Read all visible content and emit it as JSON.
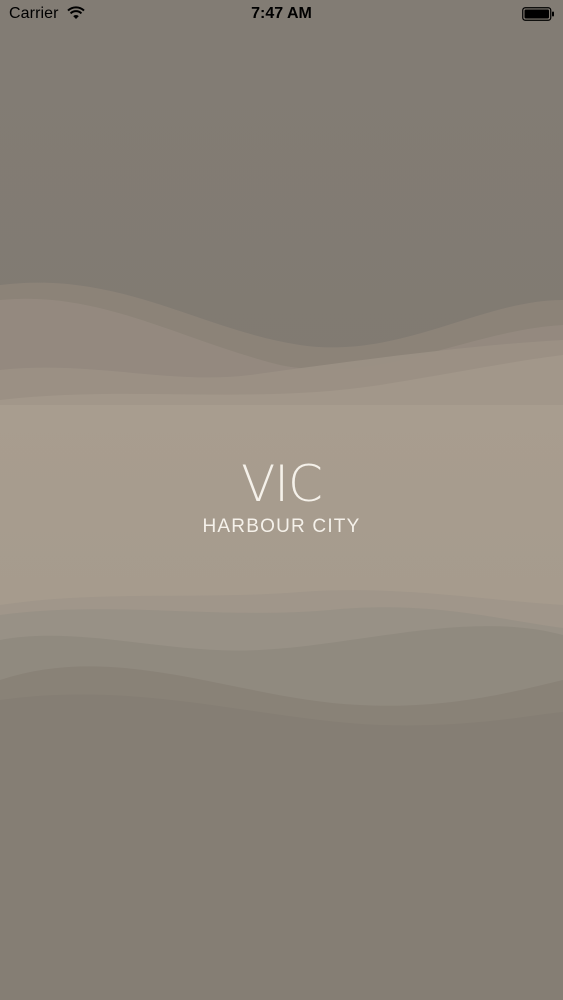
{
  "status_bar": {
    "carrier": "Carrier",
    "time": "7:47 AM",
    "wifi_icon": "wifi-icon",
    "battery_icon": "battery-icon"
  },
  "splash": {
    "title": "VIC",
    "subtitle": "HARBOUR CITY"
  },
  "colors": {
    "background_dark": "#827b72",
    "band_light": "#a89d8f",
    "text": "#f5f1ea"
  }
}
